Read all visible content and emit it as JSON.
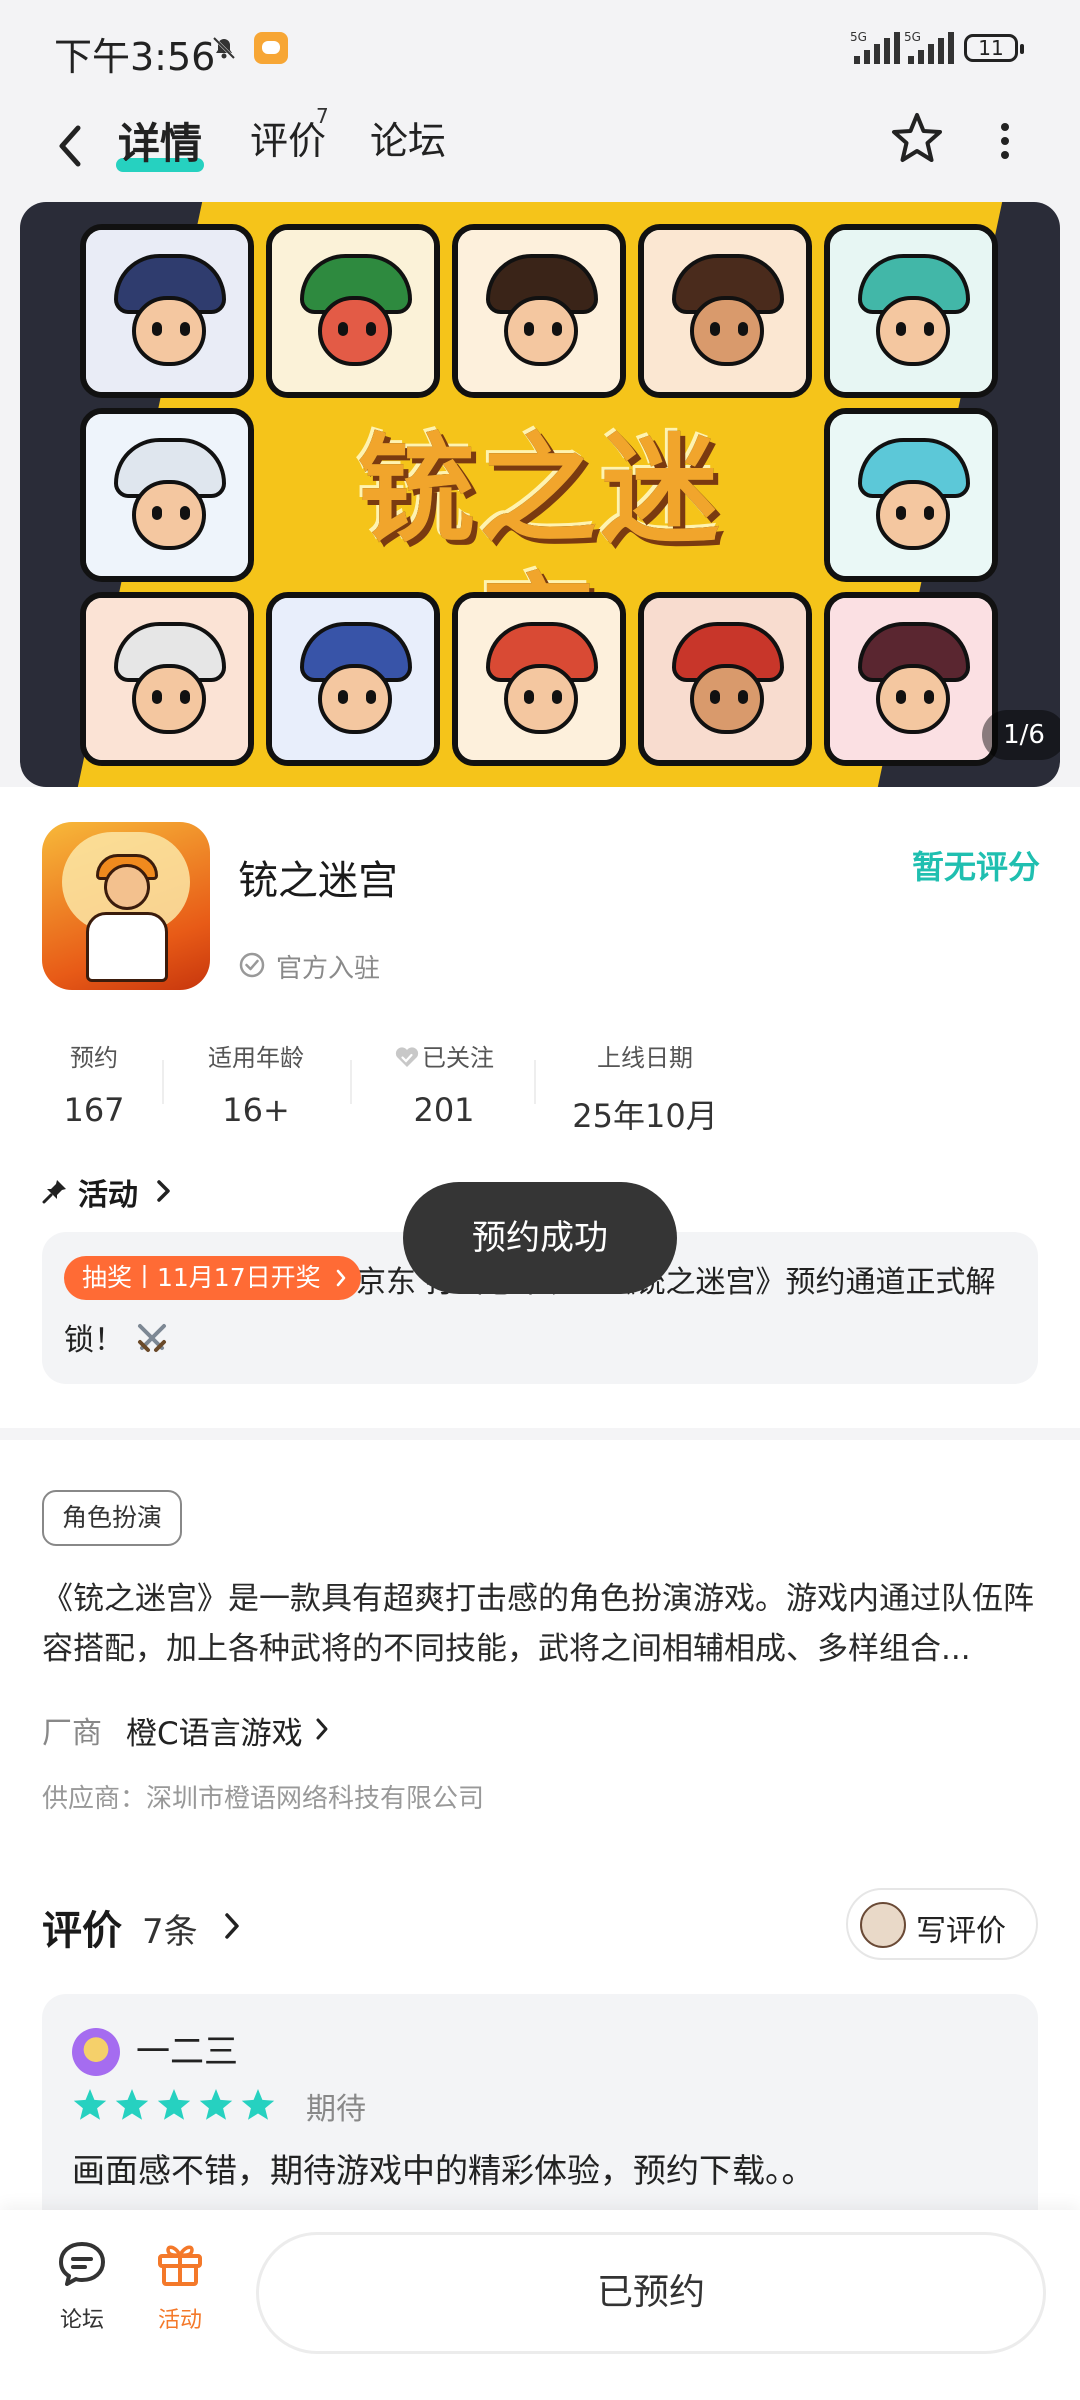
{
  "status_bar": {
    "time": "下午3:56",
    "signal_1_label": "5G",
    "signal_2_label": "5G",
    "battery": "11"
  },
  "header": {
    "tabs": [
      {
        "label": "详情",
        "active": true
      },
      {
        "label": "评价",
        "badge": "7"
      },
      {
        "label": "论坛"
      }
    ]
  },
  "banner": {
    "title": "铳之迷宫",
    "counter": "1/6"
  },
  "app": {
    "name": "铳之迷宫",
    "official_label": "官方入驻",
    "rating_label": "暂无评分",
    "accent_color": "#1fbfb0"
  },
  "stats": [
    {
      "label": "预约",
      "value": "167"
    },
    {
      "label": "适用年龄",
      "value": "16+"
    },
    {
      "label": "已关注",
      "value": "201"
    },
    {
      "label": "上线日期",
      "value": "25年10月"
    }
  ],
  "activity": {
    "title": "活动",
    "badge": "抽奖丨11月17日开奖",
    "text": "京东 打击感来袭！《铳之迷宫》预约通道正式解锁！",
    "badge_color": "#ff6b35"
  },
  "toast": "预约成功",
  "description": {
    "genre": "角色扮演",
    "text": "《铳之迷宫》是一款具有超爽打击感的角色扮演游戏。游戏内通过队伍阵容搭配，加上各种武将的不同技能，武将之间相辅相成、多样组合...",
    "vendor_label": "厂商",
    "vendor_name": "橙C语言游戏",
    "supplier": "供应商：深圳市橙语网络科技有限公司"
  },
  "reviews": {
    "title": "评价",
    "count": "7条",
    "write_label": "写评价",
    "items": [
      {
        "user": "一二三",
        "stars": 5,
        "tag": "期待",
        "text": "画面感不错，期待游戏中的精彩体验，预约下载。。"
      }
    ]
  },
  "bottom_bar": {
    "forum_label": "论坛",
    "activity_label": "活动",
    "reserved_label": "已预约",
    "activity_color": "#f4792a"
  }
}
